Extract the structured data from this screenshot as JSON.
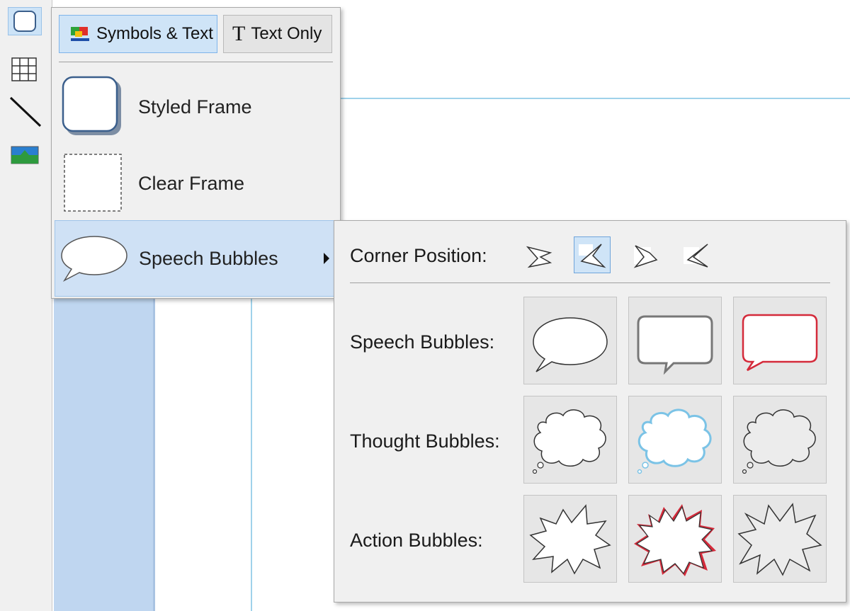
{
  "toolbar": {
    "tools": [
      {
        "icon": "frame-icon",
        "active": true
      },
      {
        "icon": "table-grid-icon",
        "active": false
      },
      {
        "icon": "line-icon",
        "active": false
      },
      {
        "icon": "picture-icon",
        "active": false
      }
    ]
  },
  "menu": {
    "modes": {
      "symbols_text": "Symbols & Text",
      "text_only": "Text Only",
      "text_only_glyph": "T"
    },
    "items": [
      {
        "label": "Styled Frame"
      },
      {
        "label": "Clear Frame"
      },
      {
        "label": "Speech Bubbles",
        "has_submenu": true
      }
    ]
  },
  "submenu": {
    "corner_label": "Corner Position:",
    "corner_positions": [
      "bottom-left",
      "bottom-left-selected",
      "bottom-right",
      "top-right"
    ],
    "rows": [
      {
        "label": "Speech Bubbles:",
        "styles": [
          "oval-plain",
          "rect-grey",
          "rect-red"
        ]
      },
      {
        "label": "Thought Bubbles:",
        "styles": [
          "cloud-plain",
          "cloud-blue",
          "cloud-grey"
        ]
      },
      {
        "label": "Action Bubbles:",
        "styles": [
          "burst-plain",
          "burst-red",
          "burst-grey"
        ]
      }
    ]
  },
  "colors": {
    "selection_blue": "#cfe4f7",
    "accent_red": "#d42a3a",
    "accent_blue": "#7bc3e6",
    "guide_line": "#9fd2ea"
  }
}
